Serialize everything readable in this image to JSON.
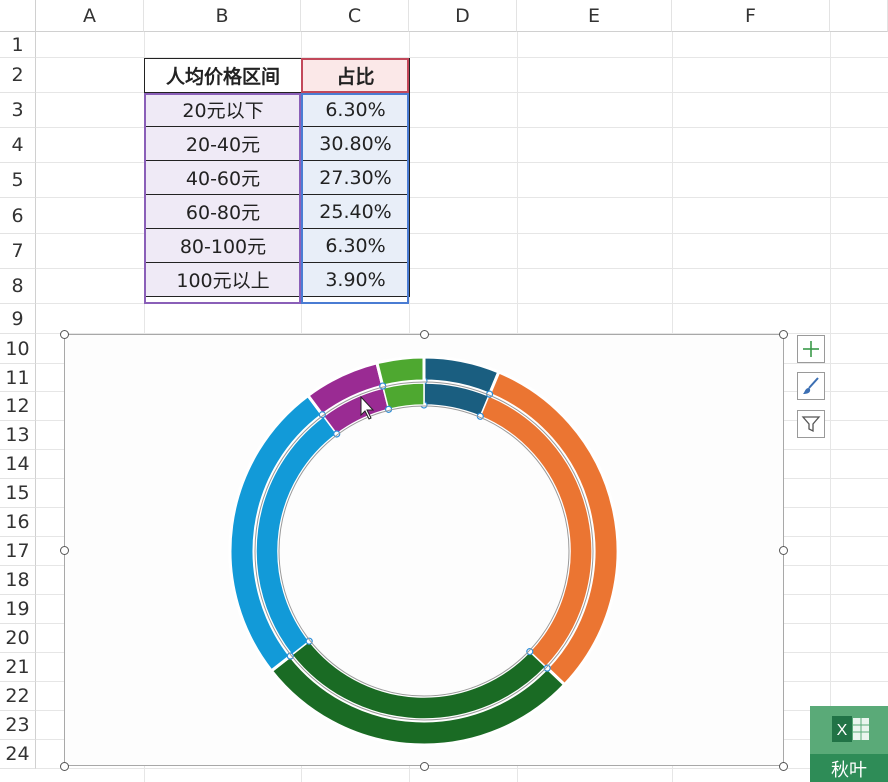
{
  "columns": [
    "A",
    "B",
    "C",
    "D",
    "E",
    "F"
  ],
  "rows": [
    "1",
    "2",
    "3",
    "4",
    "5",
    "6",
    "7",
    "8",
    "9",
    "10",
    "11",
    "12",
    "13",
    "14",
    "15",
    "16",
    "17",
    "18",
    "19",
    "20",
    "21",
    "22",
    "23",
    "24"
  ],
  "table": {
    "header": [
      "人均价格区间",
      "占比"
    ],
    "rows": [
      [
        "20元以下",
        "6.30%"
      ],
      [
        "20-40元",
        "30.80%"
      ],
      [
        "40-60元",
        "27.30%"
      ],
      [
        "60-80元",
        "25.40%"
      ],
      [
        "80-100元",
        "6.30%"
      ],
      [
        "100元以上",
        "3.90%"
      ]
    ]
  },
  "chart_data": {
    "type": "pie",
    "variant": "doughnut",
    "categories": [
      "20元以下",
      "20-40元",
      "40-60元",
      "60-80元",
      "80-100元",
      "100元以上"
    ],
    "values": [
      6.3,
      30.8,
      27.3,
      25.4,
      6.3,
      3.9
    ],
    "colors": [
      "#1a5e80",
      "#eb7532",
      "#1a6b24",
      "#129ad8",
      "#9a2b93",
      "#4ea830"
    ]
  },
  "chart_tools": [
    "plus-icon",
    "brush-icon",
    "filter-icon"
  ],
  "watermark": {
    "icon": "excel-logo-icon",
    "text": "秋叶"
  }
}
